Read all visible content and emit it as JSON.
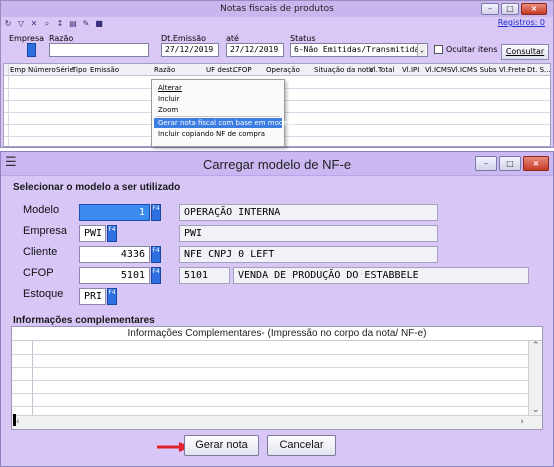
{
  "background_window": {
    "title": "Notas fiscais de produtos",
    "registros": "Registros: 0",
    "toolbar_icons": [
      "refresh-icon",
      "filter-icon",
      "filter-clear-icon",
      "search-icon",
      "sort-icon",
      "print-icon",
      "tools-icon",
      "save-icon"
    ],
    "labels": {
      "empresa": "Empresa",
      "razao": "Razão",
      "dt_emissao": "Dt.Emissão",
      "ate": "até",
      "status": "Status",
      "ocultar_itens": "Ocultar itens"
    },
    "values": {
      "dt_emissao": "27/12/2019",
      "ate": "27/12/2019",
      "status": "6-Não Emitidas/Transmitidas"
    },
    "f4": "F4",
    "consultar_label": "Consultar",
    "grid_columns": [
      "Emp",
      "Número",
      "Série",
      "Tipo",
      "Emissão",
      "Razão",
      "UF dest.",
      "CFOP",
      "Operação",
      "Situação da nota",
      "Vl.Total",
      "Vl.IPI",
      "Vl.ICMS",
      "Vl.ICMS Subs",
      "Vl.Frete",
      "Dt. S..."
    ],
    "context_menu": {
      "items": [
        "Alterar",
        "Incluir",
        "Zoom",
        "Gerar nota fiscal com base em modelo",
        "Incluir copiando NF de compra"
      ],
      "selected": "Gerar nota fiscal com base em modelo"
    }
  },
  "dialog": {
    "title": "Carregar modelo de NF-e",
    "section_model": "Selecionar o modelo a ser utilizado",
    "fields": {
      "modelo": {
        "label": "Modelo",
        "value": "1",
        "desc": "OPERAÇÃO INTERNA"
      },
      "empresa": {
        "label": "Empresa",
        "value": "PWI",
        "desc": "PWI"
      },
      "cliente": {
        "label": "Cliente",
        "value": "4336",
        "desc": "NFE CNPJ 0 LEFT"
      },
      "cfop": {
        "label": "CFOP",
        "value": "5101",
        "desc_code": "5101",
        "desc": "VENDA DE PRODUÇÃO DO ESTABBELE"
      },
      "estoque": {
        "label": "Estoque",
        "value": "PRI"
      }
    },
    "f4": "F4",
    "section_info": "Informações complementares",
    "info_header": "Informações Complementares- (Impressão no corpo da nota/ NF-e)",
    "buttons": {
      "gerar": "Gerar nota",
      "cancelar": "Cancelar"
    },
    "colors": {
      "accent": "#2d6fe0",
      "arrow": "#e0202a"
    }
  }
}
